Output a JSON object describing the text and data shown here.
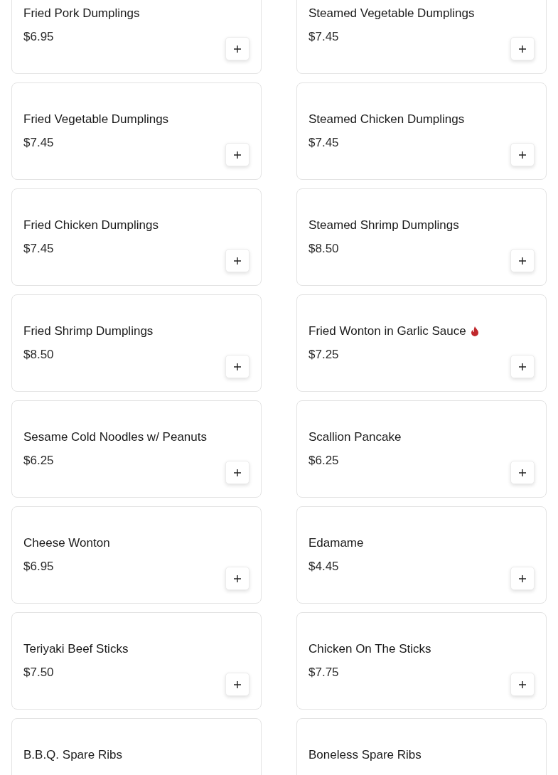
{
  "menu_items": [
    {
      "name": "Fried Pork Dumplings",
      "price": "$6.95",
      "spicy": false
    },
    {
      "name": "Steamed Vegetable Dumplings",
      "price": "$7.45",
      "spicy": false
    },
    {
      "name": "Fried Vegetable Dumplings",
      "price": "$7.45",
      "spicy": false
    },
    {
      "name": "Steamed Chicken Dumplings",
      "price": "$7.45",
      "spicy": false
    },
    {
      "name": "Fried Chicken Dumplings",
      "price": "$7.45",
      "spicy": false
    },
    {
      "name": "Steamed Shrimp Dumplings",
      "price": "$8.50",
      "spicy": false
    },
    {
      "name": "Fried Shrimp Dumplings",
      "price": "$8.50",
      "spicy": false
    },
    {
      "name": "Fried Wonton in Garlic Sauce",
      "price": "$7.25",
      "spicy": true
    },
    {
      "name": "Sesame Cold Noodles w/ Peanuts",
      "price": "$6.25",
      "spicy": false
    },
    {
      "name": "Scallion Pancake",
      "price": "$6.25",
      "spicy": false
    },
    {
      "name": "Cheese Wonton",
      "price": "$6.95",
      "spicy": false
    },
    {
      "name": "Edamame",
      "price": "$4.45",
      "spicy": false
    },
    {
      "name": "Teriyaki Beef Sticks",
      "price": "$7.50",
      "spicy": false
    },
    {
      "name": "Chicken On The Sticks",
      "price": "$7.75",
      "spicy": false
    },
    {
      "name": "B.B.Q. Spare Ribs",
      "spicy": false
    },
    {
      "name": "Boneless Spare Ribs",
      "spicy": false
    }
  ]
}
